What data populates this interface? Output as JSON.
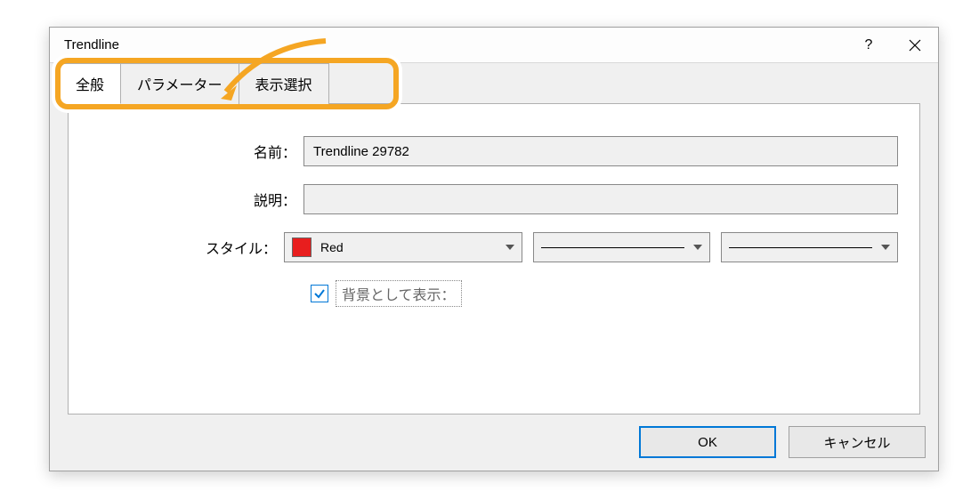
{
  "dialog": {
    "title": "Trendline"
  },
  "tabs": {
    "general": "全般",
    "parameters": "パラメーター",
    "display": "表示選択"
  },
  "form": {
    "name_label": "名前：",
    "name_value": "Trendline 29782",
    "desc_label": "説明：",
    "desc_value": "",
    "style_label": "スタイル：",
    "color_name": "Red",
    "color_hex": "#e81e1e",
    "checkbox_label": "背景として表示："
  },
  "buttons": {
    "ok": "OK",
    "cancel": "キャンセル"
  }
}
